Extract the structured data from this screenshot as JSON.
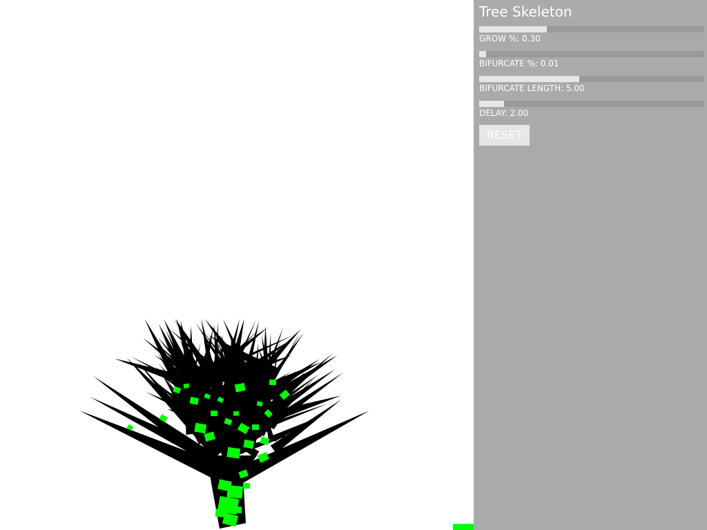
{
  "panel": {
    "title": "Tree Skeleton",
    "background_color": "#aaaaaa",
    "sliders": [
      {
        "label": "GROW %: 0.30",
        "fill_fraction": 0.3
      },
      {
        "label": "BIFURCATE %: 0.01",
        "fill_fraction": 0.03
      },
      {
        "label": "BIFURCATE LENGTH: 5.00",
        "fill_fraction": 0.445
      },
      {
        "label": "DELAY: 2.00",
        "fill_fraction": 0.11
      }
    ],
    "reset_label": "RESET"
  },
  "canvas": {
    "background_color": "#ffffff",
    "branch_color": "#000000",
    "node_color": "#00ff00"
  }
}
